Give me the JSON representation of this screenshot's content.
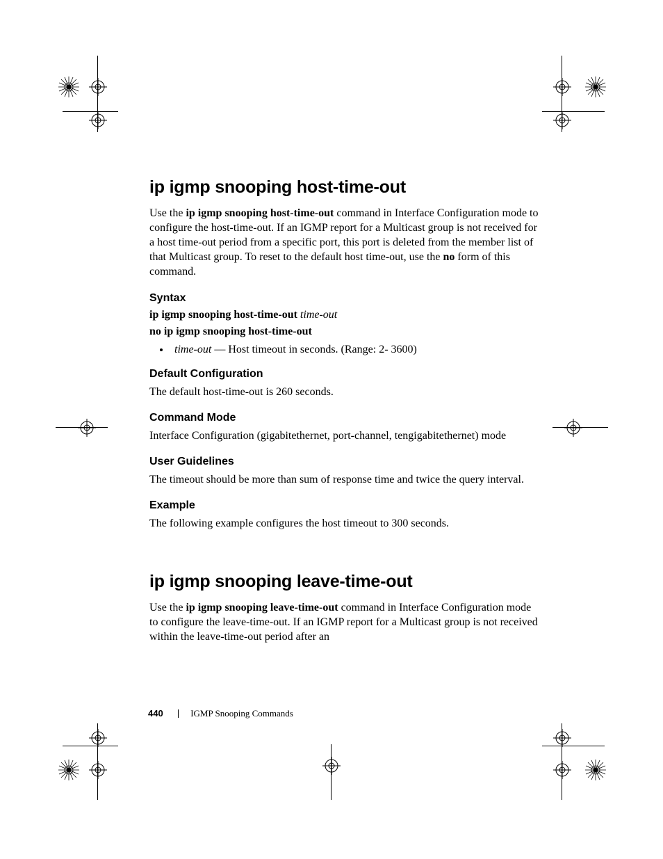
{
  "section1": {
    "title": "ip igmp snooping host-time-out",
    "intro_prefix": "Use the ",
    "intro_bold1": "ip igmp snooping host-time-out",
    "intro_mid1": " command in Interface Configuration mode to configure the host-time-out. If an IGMP report for a Multicast group is not received for a host time-out period from a specific port, this port is deleted from the member list of that Multicast group. To reset to the default host time-out, use the ",
    "intro_bold2": "no",
    "intro_suffix": " form of this command.",
    "syntax_heading": "Syntax",
    "syntax_line1_bold": "ip igmp snooping host-time-out ",
    "syntax_line1_ital": "time-out",
    "syntax_line2_bold": "no ip igmp snooping host-time-out",
    "bullet_ital": "time-out ",
    "bullet_rest": " —  Host timeout in seconds. (Range: 2- 3600)",
    "defcfg_heading": "Default Configuration",
    "defcfg_text": "The default host-time-out is 260 seconds.",
    "cmdmode_heading": "Command Mode",
    "cmdmode_text": "Interface Configuration (gigabitethernet, port-channel, tengigabitethernet) mode",
    "userguide_heading": "User Guidelines",
    "userguide_text": "The timeout should be more than sum of response time and twice the query interval.",
    "example_heading": "Example",
    "example_text": "The following example configures the host timeout to 300 seconds."
  },
  "section2": {
    "title": "ip igmp snooping leave-time-out",
    "intro_prefix": "Use the ",
    "intro_bold1": "ip igmp snooping leave-time-out",
    "intro_suffix": " command in Interface Configuration  mode to configure the leave-time-out. If an IGMP report for a Multicast group is not received within the leave-time-out period after an"
  },
  "footer": {
    "page_number": "440",
    "chapter": "IGMP Snooping Commands"
  }
}
